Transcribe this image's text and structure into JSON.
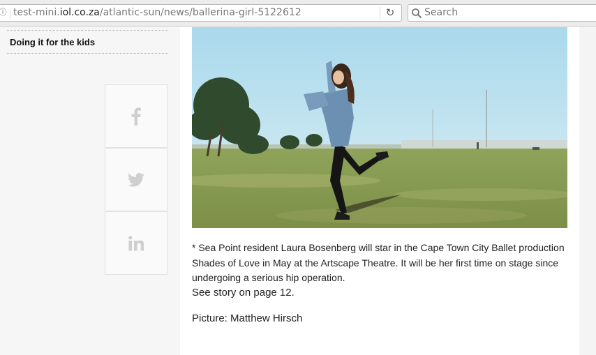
{
  "browser": {
    "url_prefix": "test-mini.",
    "url_host": "iol.co.za",
    "url_path": "/atlantic-sun/news/ballerina-girl-5122612",
    "search_placeholder": "Search"
  },
  "sidebar": {
    "related_link": "Doing it for the kids",
    "share": [
      {
        "name": "facebook",
        "icon": "facebook-icon"
      },
      {
        "name": "twitter",
        "icon": "twitter-icon"
      },
      {
        "name": "linkedin",
        "icon": "linkedin-icon"
      }
    ]
  },
  "article": {
    "caption": "* Sea Point resident Laura Bosenberg will star in the Cape Town City Ballet production Shades of Love in May at the Artscape Theatre. It will be her first time on stage since undergoing a serious hip operation.",
    "see_story": "See story on page 12.",
    "credit": "Picture: Matthew Hirsch"
  },
  "colors": {
    "sky": "#9fd0e6",
    "grass": "#8a9f55",
    "share_icon": "#cfcfcf"
  }
}
